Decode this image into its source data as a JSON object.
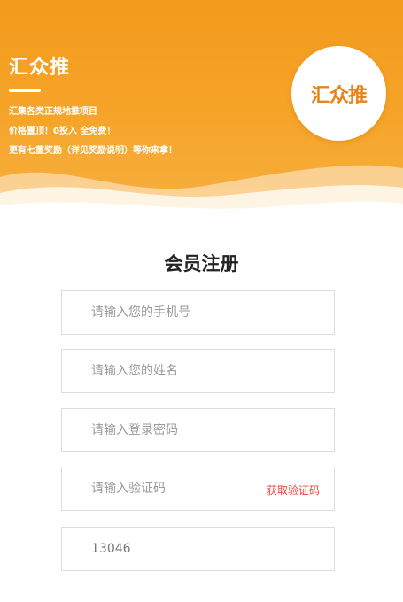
{
  "header": {
    "brand_name": "汇众推",
    "tagline_1": "汇集各类正规地推项目",
    "tagline_2": "价格置顶！0投入 全免费！",
    "tagline_3": "更有七重奖励（详见奖励说明）等你来拿！",
    "logo_text": "汇众推"
  },
  "form": {
    "title": "会员注册",
    "phone_placeholder": "请输入您的手机号",
    "name_placeholder": "请输入您的姓名",
    "password_placeholder": "请输入登录密码",
    "code_placeholder": "请输入验证码",
    "get_code_label": "获取验证码",
    "invite_code_value": "13046"
  },
  "colors": {
    "accent_orange": "#f39a1c",
    "link_red": "#e8473a"
  }
}
